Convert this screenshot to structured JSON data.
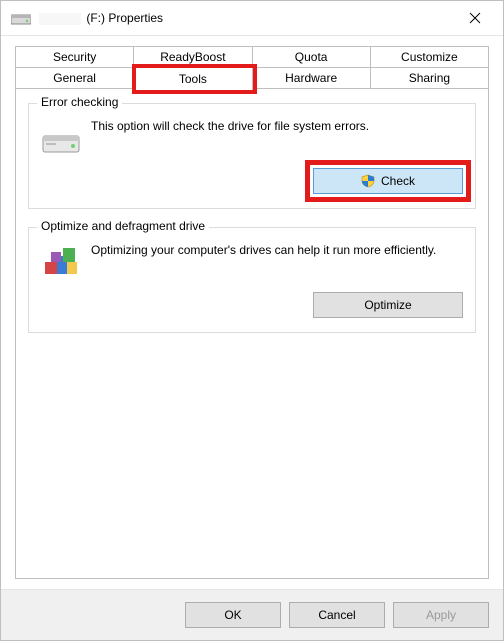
{
  "window": {
    "title_drive_letter": "(F:)",
    "title_suffix": "Properties"
  },
  "tabs": {
    "row1": [
      "Security",
      "ReadyBoost",
      "Quota",
      "Customize"
    ],
    "row2": [
      "General",
      "Tools",
      "Hardware",
      "Sharing"
    ],
    "active": "Tools"
  },
  "groups": {
    "error_checking": {
      "title": "Error checking",
      "desc": "This option will check the drive for file system errors.",
      "button": "Check"
    },
    "optimize": {
      "title": "Optimize and defragment drive",
      "desc": "Optimizing your computer's drives can help it run more efficiently.",
      "button": "Optimize"
    }
  },
  "footer": {
    "ok": "OK",
    "cancel": "Cancel",
    "apply": "Apply"
  }
}
